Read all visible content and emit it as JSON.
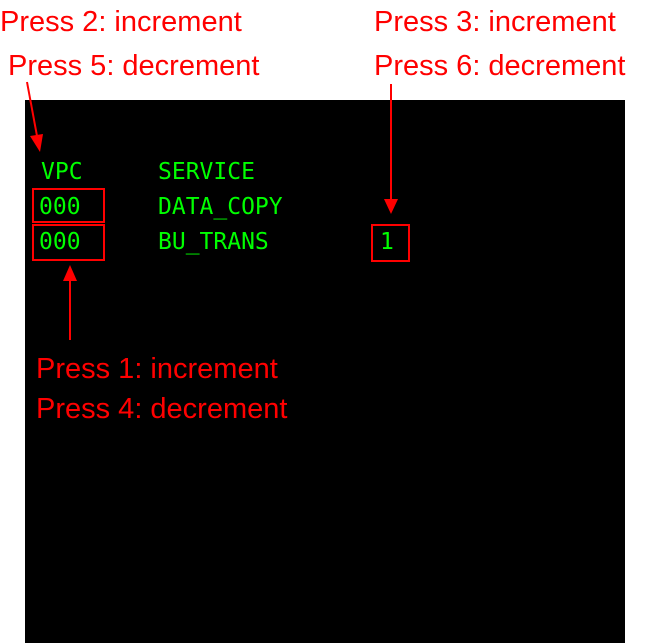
{
  "annotations": {
    "top_left": [
      "Press 2: increment",
      "Press 5: decrement"
    ],
    "top_right": [
      "Press 3: increment",
      "Press 6: decrement"
    ],
    "bottom": [
      "Press 1: increment",
      "Press 4: decrement"
    ]
  },
  "terminal": {
    "headers": {
      "vpc": "VPC",
      "service": "SERVICE"
    },
    "rows": [
      {
        "vpc": "000",
        "service": "DATA_COPY",
        "extra": ""
      },
      {
        "vpc": "000",
        "service": "BU_TRANS",
        "extra": "1"
      }
    ]
  },
  "colors": {
    "annotation": "#ff0000",
    "terminal_text": "#00ff00",
    "terminal_bg": "#000000",
    "page_bg": "#ffffff"
  }
}
